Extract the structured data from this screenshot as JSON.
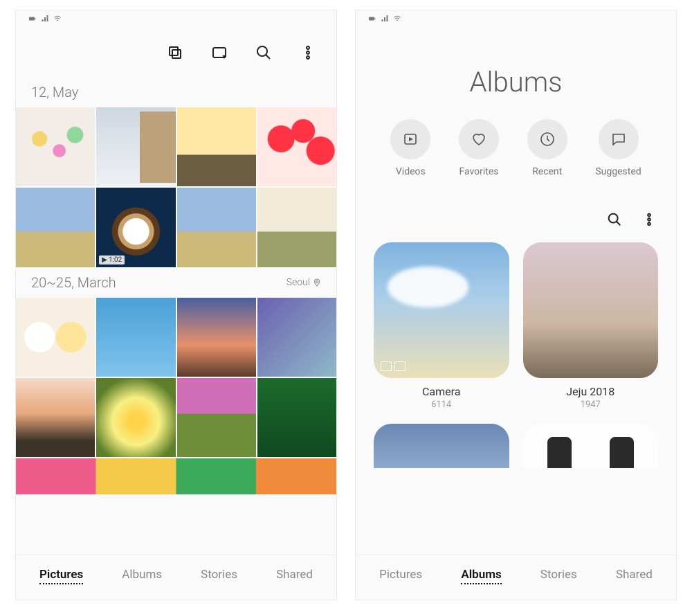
{
  "left": {
    "toolbar_icons": [
      "stack-icon",
      "gif-icon",
      "search-icon",
      "more-icon"
    ],
    "sections": [
      {
        "date": "12, May",
        "location": ""
      },
      {
        "date": "20~25, March",
        "location": "Seoul"
      }
    ],
    "video_badge": "1:02",
    "tabs": [
      "Pictures",
      "Albums",
      "Stories",
      "Shared"
    ],
    "active_tab": "Pictures"
  },
  "right": {
    "title": "Albums",
    "categories": [
      {
        "label": "Videos",
        "icon": "play-rect-icon"
      },
      {
        "label": "Favorites",
        "icon": "heart-icon"
      },
      {
        "label": "Recent",
        "icon": "clock-icon"
      },
      {
        "label": "Suggested",
        "icon": "chat-icon"
      }
    ],
    "albums": [
      {
        "title": "Camera",
        "count": "6114"
      },
      {
        "title": "Jeju 2018",
        "count": "1947"
      }
    ],
    "tabs": [
      "Pictures",
      "Albums",
      "Stories",
      "Shared"
    ],
    "active_tab": "Albums"
  }
}
